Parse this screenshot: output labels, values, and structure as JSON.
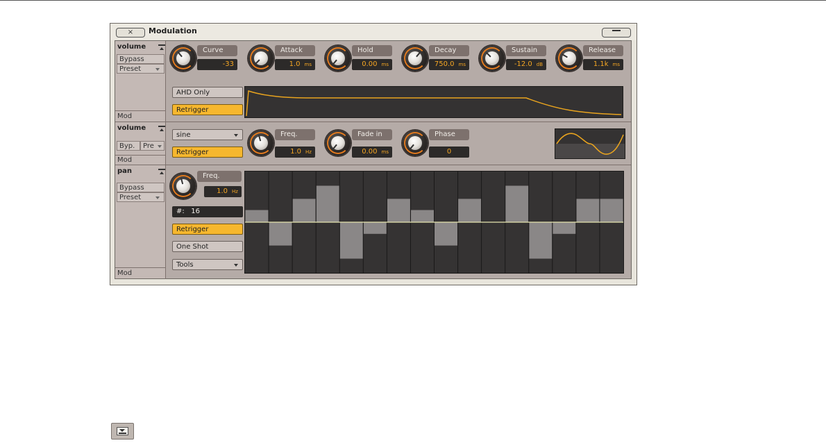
{
  "panel": {
    "title": "Modulation",
    "close_label": "×"
  },
  "slot1": {
    "name": "volume",
    "bypass": "Bypass",
    "preset": "Preset",
    "mod": "Mod",
    "mode_button": "AHD Only",
    "retrigger": "Retrigger",
    "params": [
      {
        "label": "Curve",
        "value": "-33",
        "unit": ""
      },
      {
        "label": "Attack",
        "value": "1.0",
        "unit": "ms"
      },
      {
        "label": "Hold",
        "value": "0.00",
        "unit": "ms"
      },
      {
        "label": "Decay",
        "value": "750.0",
        "unit": "ms"
      },
      {
        "label": "Sustain",
        "value": "-12.0",
        "unit": "dB"
      },
      {
        "label": "Release",
        "value": "1.1k",
        "unit": "ms"
      }
    ]
  },
  "slot2": {
    "name": "volume",
    "bypass": "Byp.",
    "preset": "Pre",
    "mod": "Mod",
    "waveform": "sine",
    "retrigger": "Retrigger",
    "params": [
      {
        "label": "Freq.",
        "value": "1.0",
        "unit": "Hz"
      },
      {
        "label": "Fade in",
        "value": "0.00",
        "unit": "ms"
      },
      {
        "label": "Phase",
        "value": "0",
        "unit": ""
      }
    ]
  },
  "slot3": {
    "name": "pan",
    "bypass": "Bypass",
    "preset": "Preset",
    "mod": "Mod",
    "freq_label": "Freq.",
    "freq_value": "1.0",
    "freq_unit": "Hz",
    "steps_label": "#:",
    "steps_value": "16",
    "retrigger": "Retrigger",
    "one_shot": "One Shot",
    "tools": "Tools",
    "step_values": [
      0.25,
      -0.48,
      0.48,
      0.75,
      -0.75,
      -0.24,
      0.48,
      0.25,
      -0.48,
      0.48,
      0,
      0.75,
      -0.75,
      -0.24,
      0.48,
      0.48
    ]
  },
  "colors": {
    "accent": "#f6b72e",
    "value_text": "#f5a623",
    "curve": "#e8a31e"
  }
}
